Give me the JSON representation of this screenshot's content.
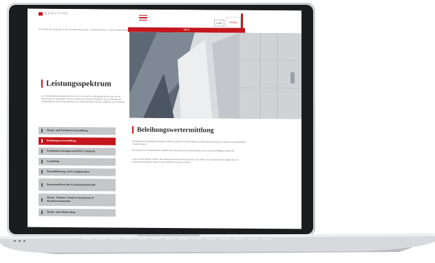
{
  "header": {
    "logo_text": "HENSTONE",
    "login_label": "Login",
    "region_label": "HomDy",
    "breadcrumb": "Ihr Partner für Leistungen in der Immobilienbewertung  ·  Leistungsspektrum  ·  Beleihungswertermittlung",
    "band_label": "Menü"
  },
  "left": {
    "title": "Leistungsspektrum",
    "intro": "Als Immobiliendienstleister bieten wir Ihnen ein breites Leistungsspektrum rund um die Bewertung von Immobilien. Unsere erfahrenen Gutachter begleiten Sie zuverlässig und unabhängig bei allen Fragestellungen im Zusammenhang mit Ihren Objekten und Portfolios.",
    "menu": [
      {
        "label": "Markt- und Verkehrswertermittlung",
        "active": false
      },
      {
        "label": "Beleihungswertermittlung",
        "active": true
      },
      {
        "label": "Portfoliobewertungen und DSGV-Analysen",
        "active": false
      },
      {
        "label": "Consulting",
        "active": false
      },
      {
        "label": "Plausibilisierung von Fremdgutachten",
        "active": false
      },
      {
        "label": "Bauzustandsberichte & Baukostenkontrolle",
        "active": false
      },
      {
        "label": "Markt-, Standort- Konkurrenzanalysen & Machbarkeitsstudien",
        "active": false
      },
      {
        "label": "Markt- und Objektrating",
        "active": false
      }
    ]
  },
  "main": {
    "title": "Beleihungswertermittlung",
    "paragraphs": [
      "Ermittlung des nachhaltig erzielbaren Wertes gemäß der Beleihungswertermittlungsverordnung zur Absicherung langfristiger Finanzierungen.",
      "Wir bewerten für Kreditinstitute Objekte aller Nutzungsarten deutschlandweit und erstellen prüffähige Gutachten.",
      "Unsere Bewertungen erfüllen die aufsichtsrechtlichen Anforderungen und bilden eine verlässliche Grundlage für Ihre Kreditentscheidungen sowie für die Risikosteuerung im Portfolio."
    ]
  },
  "colors": {
    "accent": "#c4161c",
    "menu_bg": "#c4c6c8",
    "text": "#2b2b2b"
  }
}
